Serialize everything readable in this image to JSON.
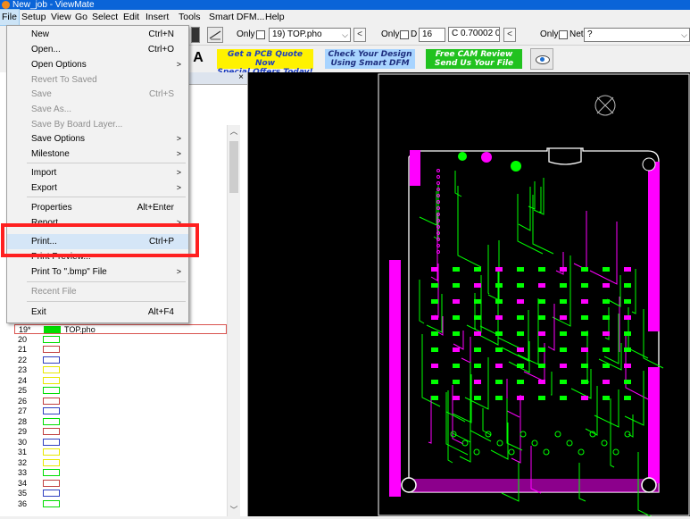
{
  "window": {
    "title": "New_job - ViewMate"
  },
  "menubar": {
    "items": [
      "File",
      "Setup",
      "View",
      "Go",
      "Select",
      "Edit",
      "Insert",
      "Tools",
      "Smart DFM...",
      "Help"
    ]
  },
  "toolbar": {
    "only_label_1": "Only",
    "layer_select": "19) TOP.pho",
    "only_label_2": "Only",
    "d_label": "D",
    "d_value": "16",
    "aperture_value": "C 0.70002 0",
    "only_label_3": "Only",
    "net_label": "Net",
    "net_value": "?",
    "axis_label": "A"
  },
  "ads": {
    "ad1_line1": "Get a PCB Quote Now",
    "ad1_line2": "Special Offers Today!",
    "ad2_line1": "Check Your Design",
    "ad2_line2": "Using Smart DFM",
    "ad3_line1": "Free CAM Review",
    "ad3_line2": "Send Us Your File"
  },
  "panel": {
    "close": "×"
  },
  "file_menu": {
    "new": {
      "label": "New",
      "shortcut": "Ctrl+N"
    },
    "open": {
      "label": "Open...",
      "shortcut": "Ctrl+O"
    },
    "open_options": {
      "label": "Open Options"
    },
    "revert": {
      "label": "Revert To Saved"
    },
    "save": {
      "label": "Save",
      "shortcut": "Ctrl+S"
    },
    "save_as": {
      "label": "Save As..."
    },
    "save_by_layer": {
      "label": "Save By Board Layer..."
    },
    "save_options": {
      "label": "Save Options"
    },
    "milestone": {
      "label": "Milestone"
    },
    "import": {
      "label": "Import"
    },
    "export": {
      "label": "Export"
    },
    "properties": {
      "label": "Properties",
      "shortcut": "Alt+Enter"
    },
    "report": {
      "label": "Report"
    },
    "print": {
      "label": "Print...",
      "shortcut": "Ctrl+P"
    },
    "print_preview": {
      "label": "Print Preview..."
    },
    "print_bmp": {
      "label": "Print To \".bmp\" File"
    },
    "recent": {
      "label": "Recent File"
    },
    "exit": {
      "label": "Exit",
      "shortcut": "Alt+F4"
    }
  },
  "layers": [
    {
      "num": "19*",
      "color": "#00dd00",
      "name": "TOP.pho"
    },
    {
      "num": "20",
      "color": "#00dd00",
      "name": ""
    },
    {
      "num": "21",
      "color": "#c04040",
      "name": ""
    },
    {
      "num": "22",
      "color": "#3040c0",
      "name": ""
    },
    {
      "num": "23",
      "color": "#e8e800",
      "name": ""
    },
    {
      "num": "24",
      "color": "#e8e800",
      "name": ""
    },
    {
      "num": "25",
      "color": "#00dd00",
      "name": ""
    },
    {
      "num": "26",
      "color": "#c04040",
      "name": ""
    },
    {
      "num": "27",
      "color": "#3040c0",
      "name": ""
    },
    {
      "num": "28",
      "color": "#00dd00",
      "name": ""
    },
    {
      "num": "29",
      "color": "#c04040",
      "name": ""
    },
    {
      "num": "30",
      "color": "#3040c0",
      "name": ""
    },
    {
      "num": "31",
      "color": "#e8e800",
      "name": ""
    },
    {
      "num": "32",
      "color": "#e8e800",
      "name": ""
    },
    {
      "num": "33",
      "color": "#00dd00",
      "name": ""
    },
    {
      "num": "34",
      "color": "#c04040",
      "name": ""
    },
    {
      "num": "35",
      "color": "#3040c0",
      "name": ""
    },
    {
      "num": "36",
      "color": "#00dd00",
      "name": ""
    }
  ],
  "colors": {
    "pcb_pad": "#ff00ff",
    "pcb_trace": "#00ff00",
    "pcb_outline": "#ffffff",
    "highlight_box": "#ff2020"
  }
}
